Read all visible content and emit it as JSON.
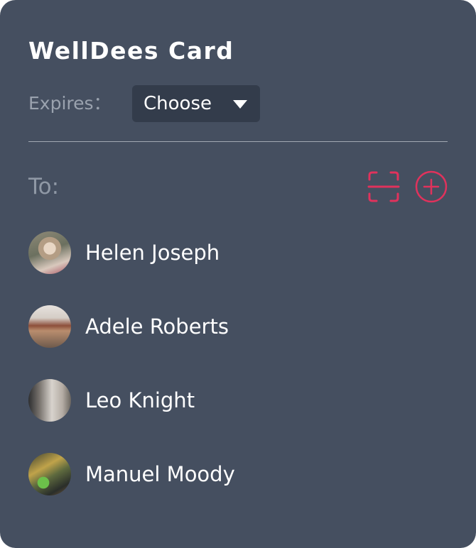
{
  "card": {
    "title": "WellDees Card",
    "expires_label": "Expires：",
    "expires_value": "Choose",
    "to_label": "To:",
    "accent_color": "#e0325c",
    "background_color": "#454f60",
    "icons": {
      "scan": "scan-icon",
      "add": "add-circle-icon",
      "dropdown": "caret-down-icon"
    }
  },
  "contacts": [
    {
      "name": "Helen Joseph"
    },
    {
      "name": "Adele Roberts"
    },
    {
      "name": "Leo Knight"
    },
    {
      "name": "Manuel Moody"
    }
  ]
}
